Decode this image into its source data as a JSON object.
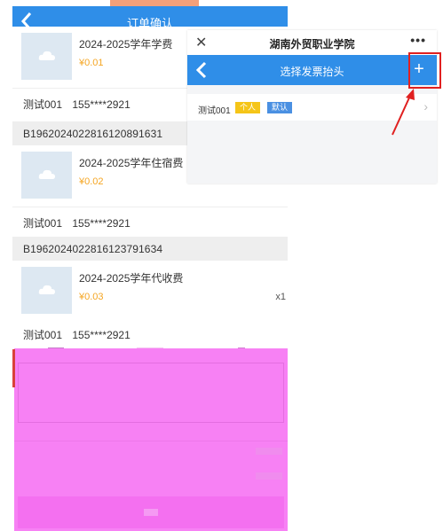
{
  "phone": {
    "title": "订单确认",
    "items": [
      {
        "name": "2024-2025学年学费",
        "price": "¥0.01",
        "qty": ""
      },
      {
        "name": "2024-2025学年住宿费",
        "price": "¥0.02",
        "qty": ""
      },
      {
        "name": "2024-2025学年代收费",
        "price": "¥0.03",
        "qty": "x1"
      }
    ],
    "contacts": [
      {
        "name": "测试001",
        "phone": "155****2921"
      },
      {
        "name": "测试001",
        "phone": "155****2921"
      },
      {
        "name": "测试001",
        "phone": "155****2921"
      }
    ],
    "order_numbers": [
      "B1962024022816120891631",
      "B1962024022816123791634"
    ]
  },
  "dialog": {
    "school": "湖南外贸职业学院",
    "close_icon": "close-icon",
    "more": "•••",
    "title": "选择发票抬头",
    "add_label": "+",
    "row": {
      "name": "测试001",
      "tag_personal": "个人",
      "tag_default": "默认",
      "chevron": "›"
    }
  },
  "colors": {
    "primary": "#2f8ee8",
    "price": "#f5a623",
    "annotation": "#e02020",
    "redaction": "#f781f4"
  }
}
